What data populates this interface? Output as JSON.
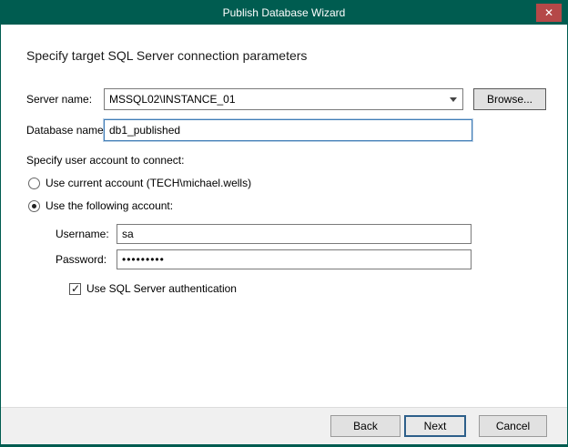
{
  "window": {
    "title": "Publish Database Wizard",
    "close_glyph": "✕",
    "accent_color": "#005c50"
  },
  "heading": "Specify target SQL Server connection parameters",
  "form": {
    "server": {
      "label": "Server name:",
      "value": "MSSQL02\\INSTANCE_01",
      "browse_label": "Browse..."
    },
    "database": {
      "label": "Database name:",
      "value": "db1_published"
    },
    "account_section_label": "Specify user account to connect:",
    "radio_current": {
      "label": "Use current account (TECH\\michael.wells)",
      "selected": false
    },
    "radio_following": {
      "label": "Use the following account:",
      "selected": true
    },
    "username": {
      "label": "Username:",
      "value": "sa"
    },
    "password": {
      "label": "Password:",
      "value": "•••••••••"
    },
    "sql_auth_checkbox": {
      "label": "Use SQL Server authentication",
      "checked": true
    }
  },
  "footer": {
    "back_label": "Back",
    "next_label": "Next",
    "cancel_label": "Cancel"
  }
}
